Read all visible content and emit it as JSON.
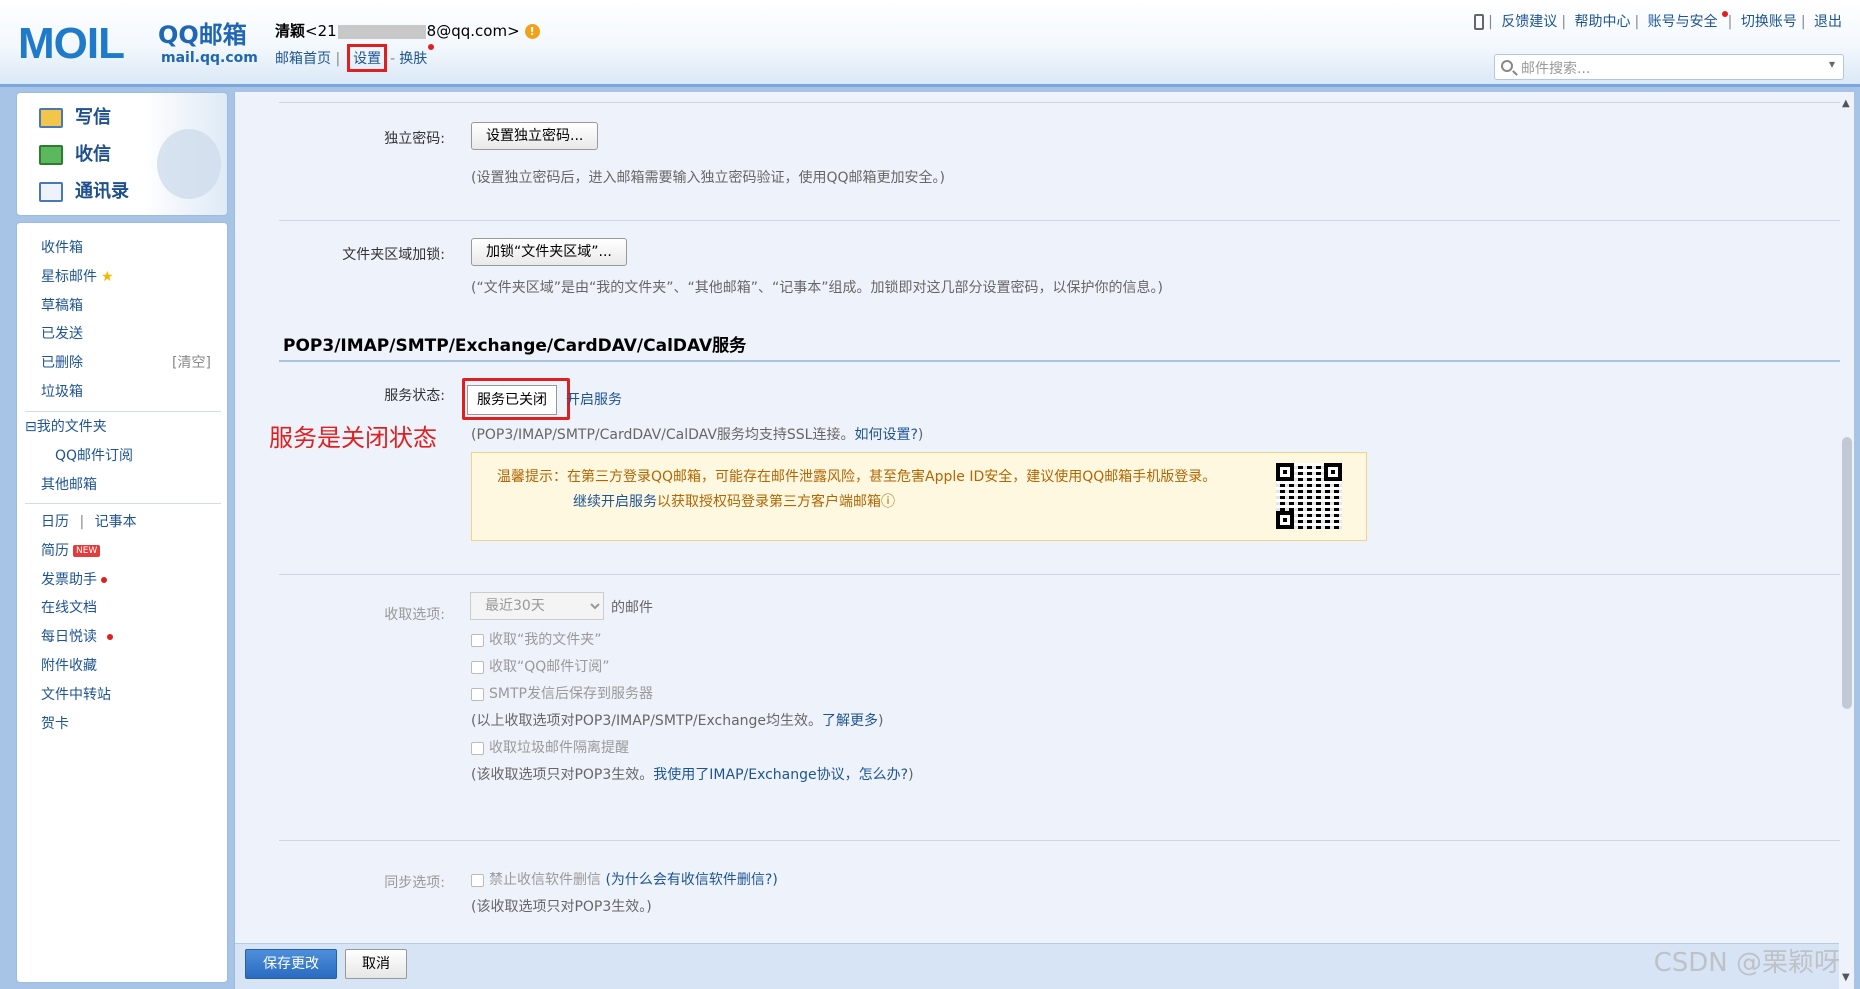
{
  "logo": {
    "mark": "MOIL",
    "cn": "QQ邮箱",
    "domain": "mail.qq.com"
  },
  "user": {
    "name": "清颖",
    "email_prefix": "<21",
    "email_suffix": "8@qq.com>",
    "warn_icon": "!"
  },
  "topnav": {
    "home": "邮箱首页",
    "sep1": "|",
    "settings": "设置",
    "sep2": "-",
    "skin": "换肤"
  },
  "toplinks": {
    "feedback": "反馈建议",
    "help": "帮助中心",
    "account_security": "账号与安全",
    "switch": "切换账号",
    "logout": "退出",
    "sep": "|"
  },
  "search": {
    "placeholder": "邮件搜索..."
  },
  "quick": {
    "write": "写信",
    "inbox": "收信",
    "contacts": "通讯录"
  },
  "folders": {
    "inbox": "收件箱",
    "starred": "星标邮件",
    "drafts": "草稿箱",
    "sent": "已发送",
    "deleted": "已删除",
    "clear": "[清空]",
    "spam": "垃圾箱",
    "my_folders": "⊟我的文件夹",
    "subscriptions": "QQ邮件订阅",
    "other_mail": "其他邮箱",
    "calendar": "日历",
    "pipe": "|",
    "notes": "记事本",
    "resume": "简历",
    "new_badge": "NEW",
    "invoice": "发票助手",
    "docs": "在线文档",
    "daily": "每日悦读",
    "attachments": "附件收藏",
    "transfer": "文件中转站",
    "cards": "贺卡"
  },
  "settings": {
    "pwd_label": "独立密码:",
    "pwd_btn": "设置独立密码...",
    "pwd_hint": "(设置独立密码后，进入邮箱需要输入独立密码验证，使用QQ邮箱更加安全。)",
    "lock_label": "文件夹区域加锁:",
    "lock_btn": "加锁“文件夹区域”...",
    "lock_hint": "(“文件夹区域”是由“我的文件夹”、“其他邮箱”、“记事本”组成。加锁即对这几部分设置密码，以保护你的信息。)",
    "section_title": "POP3/IMAP/SMTP/Exchange/CardDAV/CalDAV服务",
    "status_label": "服务状态:",
    "status_btn": "服务已关闭",
    "open_link": "开启服务",
    "annotation": "服务是关闭状态",
    "ssl_hint_a": "(POP3/IMAP/SMTP/CardDAV/CalDAV服务均支持SSL连接。",
    "ssl_hint_link": "如何设置?",
    "ssl_hint_b": ")",
    "warn_line1": "温馨提示：在第三方登录QQ邮箱，可能存在邮件泄露风险，甚至危害Apple ID安全，建议使用QQ邮箱手机版登录。",
    "warn_line2_link": "继续开启服务",
    "warn_line2_rest": "以获取授权码登录第三方客户端邮箱",
    "fetch_label": "收取选项:",
    "fetch_select": "最近30天",
    "fetch_suffix": "的邮件",
    "cb1": "收取“我的文件夹”",
    "cb2": "收取“QQ邮件订阅”",
    "cb3": "SMTP发信后保存到服务器",
    "fetch_hint_a": "(以上收取选项对POP3/IMAP/SMTP/Exchange均生效。",
    "fetch_hint_link": "了解更多",
    "fetch_hint_b": ")",
    "cb4": "收取垃圾邮件隔离提醒",
    "pop3_hint_a": "(该收取选项只对POP3生效。",
    "pop3_hint_link": "我使用了IMAP/Exchange协议，怎么办?",
    "pop3_hint_b": ")",
    "sync_label": "同步选项:",
    "cb5": "禁止收信软件删信",
    "sync_link": "(为什么会有收信软件删信?)",
    "sync_hint": "(该收取选项只对POP3生效。)"
  },
  "footer": {
    "save": "保存更改",
    "cancel": "取消"
  },
  "watermark": "CSDN @栗颖呀"
}
